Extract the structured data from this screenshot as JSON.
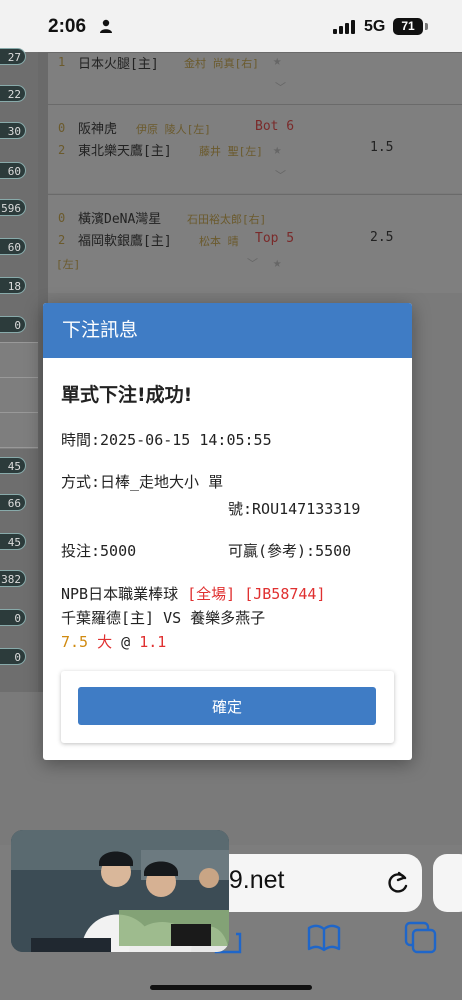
{
  "status": {
    "time": "2:06",
    "network": "5G",
    "battery": "71"
  },
  "background": {
    "side_pills": [
      "27",
      "22",
      "30",
      "60",
      "596",
      "60",
      "18",
      "0",
      "45",
      "66",
      "45",
      "382",
      "0",
      "0"
    ],
    "matches": [
      {
        "score1": "",
        "team1": "",
        "pitcher1": "",
        "score2": "1",
        "team2": "日本火腿[主]",
        "pitcher2": "金村 尚真[右]",
        "inning": "",
        "odds": ""
      },
      {
        "score1": "0",
        "team1": "阪神虎",
        "pitcher1": "伊原 陵人[左]",
        "score2": "2",
        "team2": "東北樂天鷹[主]",
        "pitcher2": "藤井 聖[左]",
        "inning": "Bot 6",
        "odds": "1.5"
      },
      {
        "score1": "0",
        "team1": "橫濱DeNA灣星",
        "pitcher1": "石田裕太郎[右]",
        "score2": "2",
        "team2": "福岡軟銀鷹[主]",
        "pitcher2": "松本 晴",
        "pitcher2_cont": "[左]",
        "inning": "Top 5",
        "odds": "2.5"
      }
    ]
  },
  "modal": {
    "header": "下注訊息",
    "title": "單式下注!成功!",
    "time_label": "時間:2025-06-15 14:05:55",
    "method_label": "方式:日棒_走地大小 單",
    "order_label": "號:ROU147133319",
    "stake_label": "投注:5000",
    "win_label": "可贏(參考):5500",
    "league": "NPB日本職業棒球",
    "scope": "[全場]",
    "bet_code": "[JB58744]",
    "teams": "千葉羅德[主] VS 養樂多燕子",
    "line_value": "7.5",
    "line_side": "大",
    "at": "@",
    "odds": "1.1",
    "confirm": "確定"
  },
  "browser": {
    "url": "99.net"
  },
  "colors": {
    "accent": "#3f7cc5",
    "red": "#e03030",
    "orange": "#d08a10"
  }
}
